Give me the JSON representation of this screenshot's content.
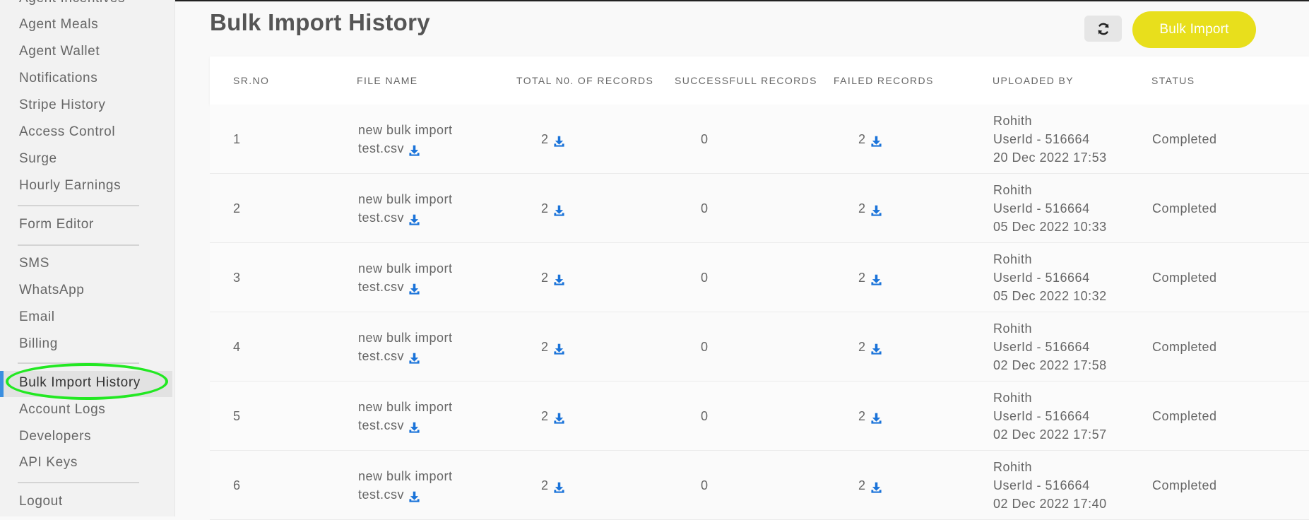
{
  "sidebar": {
    "cut_item": "Agent Incentives",
    "items_top": [
      "Agent Meals",
      "Agent Wallet",
      "Notifications",
      "Stripe History",
      "Access Control",
      "Surge",
      "Hourly Earnings"
    ],
    "form_editor": "Form Editor",
    "items_mid": [
      "SMS",
      "WhatsApp",
      "Email",
      "Billing"
    ],
    "active": "Bulk Import History",
    "items_bottom": [
      "Account Logs",
      "Developers",
      "API Keys"
    ],
    "logout": "Logout"
  },
  "header": {
    "title": "Bulk Import History",
    "bulk_import_label": "Bulk Import"
  },
  "table": {
    "columns": [
      "SR.NO",
      "FILE NAME",
      "TOTAL N0. OF RECORDS",
      "SUCCESSFULL RECORDS",
      "FAILED RECORDS",
      "UPLOADED BY",
      "STATUS"
    ],
    "rows": [
      {
        "sr": "1",
        "file_line1": "new bulk import",
        "file_line2": "test.csv",
        "total": "2",
        "success": "0",
        "failed": "2",
        "user": "Rohith",
        "user_id": "UserId - 516664",
        "date": "20 Dec 2022 17:53",
        "status": "Completed"
      },
      {
        "sr": "2",
        "file_line1": "new bulk import",
        "file_line2": "test.csv",
        "total": "2",
        "success": "0",
        "failed": "2",
        "user": "Rohith",
        "user_id": "UserId - 516664",
        "date": "05 Dec 2022 10:33",
        "status": "Completed"
      },
      {
        "sr": "3",
        "file_line1": "new bulk import",
        "file_line2": "test.csv",
        "total": "2",
        "success": "0",
        "failed": "2",
        "user": "Rohith",
        "user_id": "UserId - 516664",
        "date": "05 Dec 2022 10:32",
        "status": "Completed"
      },
      {
        "sr": "4",
        "file_line1": "new bulk import",
        "file_line2": "test.csv",
        "total": "2",
        "success": "0",
        "failed": "2",
        "user": "Rohith",
        "user_id": "UserId - 516664",
        "date": "02 Dec 2022 17:58",
        "status": "Completed"
      },
      {
        "sr": "5",
        "file_line1": "new bulk import",
        "file_line2": "test.csv",
        "total": "2",
        "success": "0",
        "failed": "2",
        "user": "Rohith",
        "user_id": "UserId - 516664",
        "date": "02 Dec 2022 17:57",
        "status": "Completed"
      },
      {
        "sr": "6",
        "file_line1": "new bulk import",
        "file_line2": "test.csv",
        "total": "2",
        "success": "0",
        "failed": "2",
        "user": "Rohith",
        "user_id": "UserId - 516664",
        "date": "02 Dec 2022 17:40",
        "status": "Completed"
      }
    ]
  },
  "icons": {
    "download": "download-icon",
    "refresh": "refresh-icon"
  },
  "colors": {
    "accent_yellow": "#e8df1c",
    "download_blue": "#1a73d9",
    "active_bar": "#3b8fe0",
    "highlight_green": "#22e822"
  }
}
